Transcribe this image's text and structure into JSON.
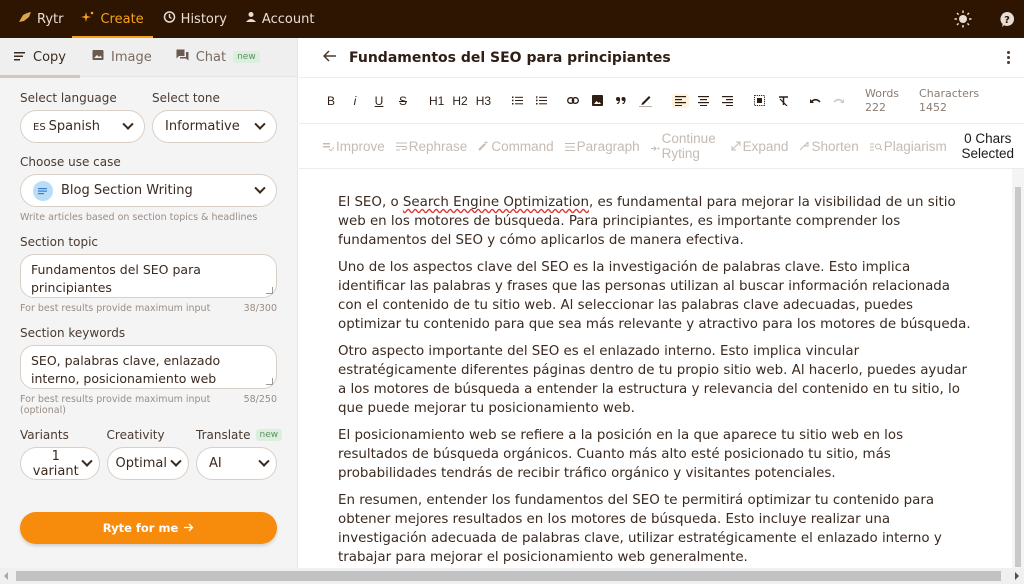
{
  "nav": {
    "brand": "Rytr",
    "items": [
      {
        "label": "Create",
        "icon": "sparkle-icon",
        "active": true
      },
      {
        "label": "History",
        "icon": "history-icon",
        "active": false
      },
      {
        "label": "Account",
        "icon": "user-icon",
        "active": false
      }
    ],
    "right_icons": [
      "sun-icon",
      "help-icon"
    ]
  },
  "subtabs": [
    {
      "label": "Copy",
      "active": true
    },
    {
      "label": "Image",
      "active": false
    },
    {
      "label": "Chat",
      "active": false,
      "badge": "new"
    }
  ],
  "form": {
    "language_label": "Select language",
    "language_prefix": "ES",
    "language_value": "Spanish",
    "tone_label": "Select tone",
    "tone_value": "Informative",
    "usecase_label": "Choose use case",
    "usecase_value": "Blog Section Writing",
    "usecase_hint": "Write articles based on section topics & headlines",
    "topic_label": "Section topic",
    "topic_value": "Fundamentos del SEO para principiantes",
    "topic_hint": "For best results provide maximum input",
    "topic_count": "38/300",
    "keywords_label": "Section keywords",
    "keywords_value": "SEO, palabras clave, enlazado interno, posicionamiento web",
    "keywords_hint": "For best results provide maximum input (optional)",
    "keywords_count": "58/250",
    "variants_label": "Variants",
    "variants_value": "1 variant",
    "creativity_label": "Creativity",
    "creativity_value": "Optimal",
    "translate_label": "Translate",
    "translate_badge": "new",
    "translate_value": "AI",
    "submit_label": "Ryte for me"
  },
  "document": {
    "title": "Fundamentos del SEO para principiantes",
    "toolbar": {
      "bold": "B",
      "italic": "i",
      "underline": "U",
      "strike": "S",
      "h1": "H1",
      "h2": "H2",
      "h3": "H3"
    },
    "words_label": "Words",
    "words_value": "222",
    "chars_label": "Characters",
    "chars_value": "1452",
    "ai_actions": [
      "Improve",
      "Rephrase",
      "Command",
      "Paragraph",
      "Continue Ryting",
      "Expand",
      "Shorten",
      "Plagiarism"
    ],
    "chars_selected_line1": "0 Chars",
    "chars_selected_line2": "Selected",
    "p1_pre": "El SEO, o ",
    "p1_mark": "Search Engine Optimization",
    "p1_post": ", es fundamental para mejorar la visibilidad de un sitio web en los motores de búsqueda. Para principiantes, es importante comprender los fundamentos del SEO y cómo aplicarlos de manera efectiva.",
    "paragraphs": [
      "Uno de los aspectos clave del SEO es la investigación de palabras clave. Esto implica identificar las palabras y frases que las personas utilizan al buscar información relacionada con el contenido de tu sitio web. Al seleccionar las palabras clave adecuadas, puedes optimizar tu contenido para que sea más relevante y atractivo para los motores de búsqueda.",
      "Otro aspecto importante del SEO es el enlazado interno. Esto implica vincular estratégicamente diferentes páginas dentro de tu propio sitio web. Al hacerlo, puedes ayudar a los motores de búsqueda a entender la estructura y relevancia del contenido en tu sitio, lo que puede mejorar tu posicionamiento web.",
      "El posicionamiento web se refiere a la posición en la que aparece tu sitio web en los resultados de búsqueda orgánicos. Cuanto más alto esté posicionado tu sitio, más probabilidades tendrás de recibir tráfico orgánico y visitantes potenciales.",
      "En resumen, entender los fundamentos del SEO te permitirá optimizar tu contenido para obtener mejores resultados en los motores de búsqueda. Esto incluye realizar una investigación adecuada de palabras clave, utilizar estratégicamente el enlazado interno y trabajar para mejorar el posicionamiento web generalmente."
    ]
  },
  "colors": {
    "nav_bg": "#2e1502",
    "accent": "#f7a21b",
    "button": "#f68b0c"
  }
}
